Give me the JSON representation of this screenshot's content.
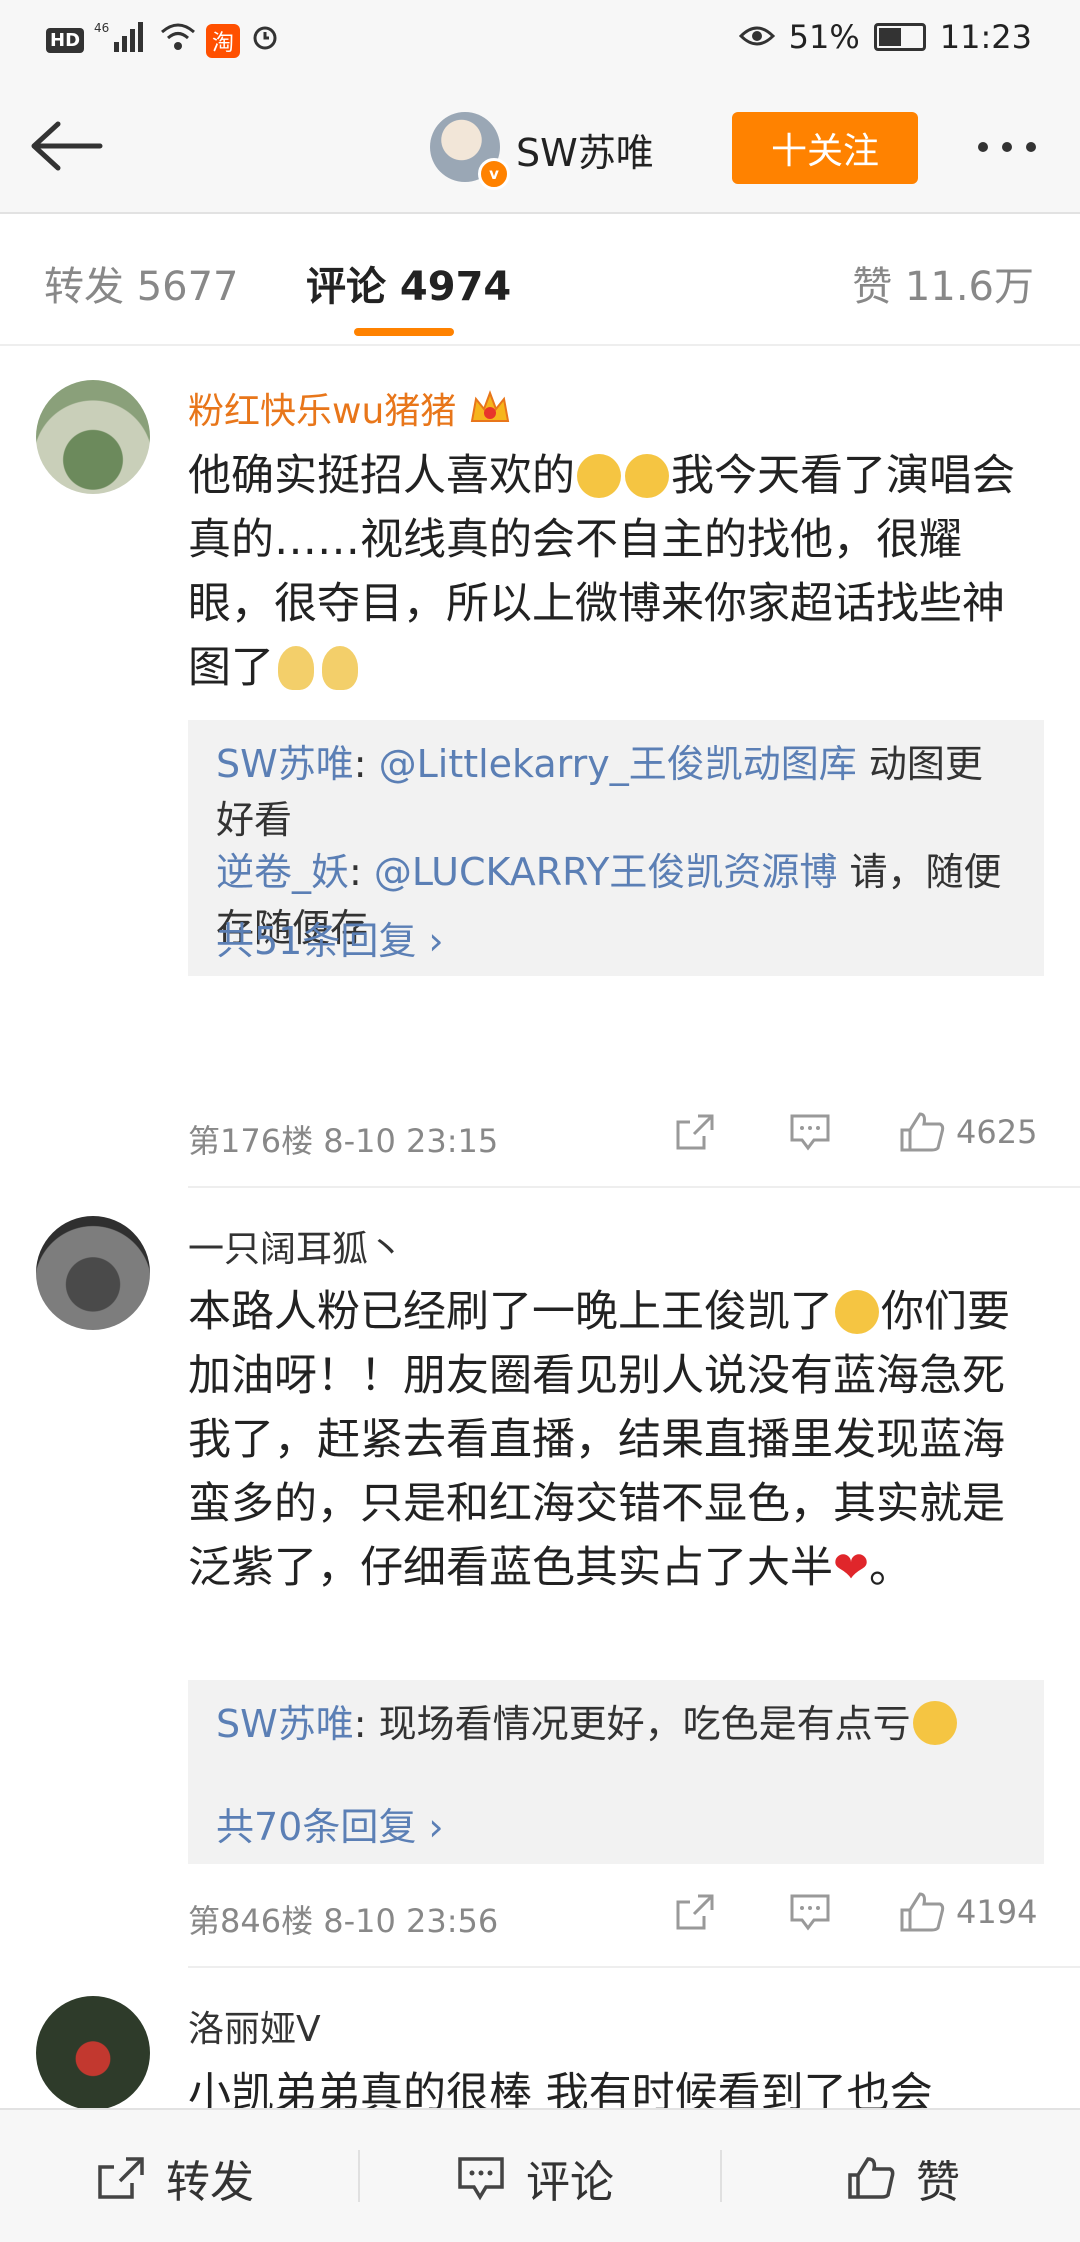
{
  "status_bar": {
    "hd": "HD",
    "network": "46",
    "battery": "51%",
    "time": "11:23",
    "taobao": "淘"
  },
  "header": {
    "title": "SW苏唯",
    "follow_label": "十关注"
  },
  "tabs": [
    {
      "label": "转发 5677"
    },
    {
      "label": "评论 4974"
    },
    {
      "label": "赞 11.6万"
    }
  ],
  "comments": [
    {
      "name": "粉红快乐wu猪猪",
      "text_parts": [
        "他确实挺招人喜欢的",
        "我今天看了演唱会真的……视线真的会不自主的找他，很耀眼，很夺目，所以上微博来你家超话找些神图了"
      ],
      "replies": [
        {
          "user": "SW苏唯",
          "mention": "@Littlekarry_王俊凯动图库",
          "text": " 动图更好看"
        },
        {
          "user": "逆卷_妖",
          "mention": "@LUCKARRY王俊凯资源博",
          "text": " 请，随便存随便存"
        }
      ],
      "more": "共51条回复 ›",
      "floor_time": "第176楼  8-10 23:15",
      "likes": "4625"
    },
    {
      "name": "一只阔耳狐丶",
      "text_a": "本路人粉已经刷了一晚上王俊凯了",
      "text_b": "你们要加油呀！！朋友圈看见别人说没有蓝海急死我了，赶紧去看直播，结果直播里发现蓝海蛮多的，只是和红海交错不显色，其实就是泛紫了，仔细看蓝色其实占了大半",
      "text_c": "。",
      "replies": [
        {
          "user": "SW苏唯",
          "mention": "",
          "text": ": 现场看情况更好，吃色是有点亏"
        }
      ],
      "more": "共70条回复 ›",
      "floor_time": "第846楼  8-10 23:56",
      "likes": "4194"
    },
    {
      "name": "洛丽娅V",
      "text": "小凯弟弟真的很棒 我有时候看到了也会"
    }
  ],
  "bottom_bar": {
    "repost": "转发",
    "comment": "评论",
    "like": "赞"
  },
  "colors": {
    "accent": "#ff8200",
    "link": "#5b7fb5",
    "vip_name": "#e8761a"
  }
}
